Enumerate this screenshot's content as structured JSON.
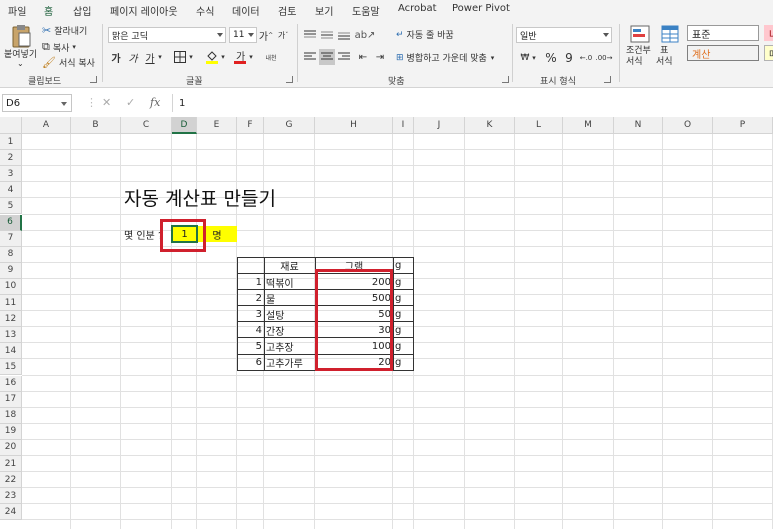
{
  "ribbon": {
    "tabs": [
      "파일",
      "홈",
      "삽입",
      "페이지 레이아웃",
      "수식",
      "데이터",
      "검토",
      "보기",
      "도움말",
      "Acrobat",
      "Power Pivot"
    ],
    "active_tab": "홈",
    "clipboard": {
      "paste_label": "붙여넣기",
      "cut_label": "잘라내기",
      "copy_label": "복사",
      "format_painter_label": "서식 복사",
      "group_label": "클립보드"
    },
    "font": {
      "font_name": "맑은 고딕",
      "font_size": "11",
      "bold": "가",
      "italic": "가",
      "underline": "가",
      "grow": "가",
      "shrink": "가",
      "phonetic": "내천",
      "group_label": "글꼴"
    },
    "alignment": {
      "wrap_label": "자동 줄 바꿈",
      "merge_label": "병합하고 가운데 맞춤",
      "group_label": "맞춤"
    },
    "number": {
      "format": "일반",
      "group_label": "표시 형식"
    },
    "styles": {
      "conditional_label": "조건부\n서식",
      "table_label": "표\n서식",
      "style_normal": "표준",
      "style_calc": "계산",
      "style_bad": "나",
      "style_memo": "메"
    }
  },
  "formula_bar": {
    "name_box": "D6",
    "value": "1",
    "cancel_icon": "close-icon",
    "enter_icon": "check-icon",
    "fx_label": "fx"
  },
  "sheet": {
    "columns": [
      "A",
      "B",
      "C",
      "D",
      "E",
      "F",
      "G",
      "H",
      "I",
      "J",
      "K",
      "L",
      "M",
      "N",
      "O",
      "P"
    ],
    "rows": [
      "1",
      "2",
      "3",
      "4",
      "5",
      "6",
      "7",
      "8",
      "9",
      "10",
      "11",
      "12",
      "13",
      "14",
      "15",
      "16",
      "17",
      "18",
      "19",
      "20",
      "21",
      "22",
      "23",
      "24"
    ],
    "selected_cell": "D6",
    "title": "자동 계산표 만들기",
    "people_label": "몇 인분 ?",
    "people_value": "1",
    "people_unit": "명",
    "table": {
      "header_ingredient": "재료",
      "header_gram": "그램",
      "unit_header": "g",
      "rows": [
        {
          "no": "1",
          "name": "떡볶이",
          "gram": "200",
          "unit": "g"
        },
        {
          "no": "2",
          "name": "물",
          "gram": "500",
          "unit": "g"
        },
        {
          "no": "3",
          "name": "설탕",
          "gram": "50",
          "unit": "g"
        },
        {
          "no": "4",
          "name": "간장",
          "gram": "30",
          "unit": "g"
        },
        {
          "no": "5",
          "name": "고추장",
          "gram": "100",
          "unit": "g"
        },
        {
          "no": "6",
          "name": "고추가루",
          "gram": "20",
          "unit": "g"
        }
      ]
    },
    "highlight_color": "#d0202d",
    "input_fill_color": "#ffff00"
  }
}
